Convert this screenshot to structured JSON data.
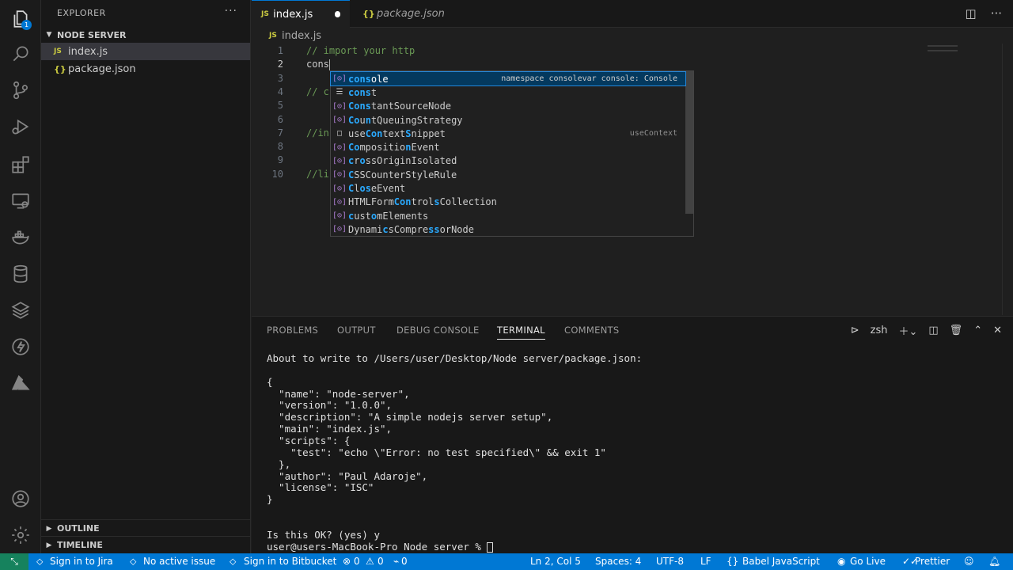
{
  "sidebar": {
    "title": "EXPLORER",
    "more": "···",
    "folder": "NODE SERVER",
    "files": [
      {
        "icon": "JS",
        "name": "index.js"
      },
      {
        "icon": "{}",
        "name": "package.json"
      }
    ],
    "outline": "OUTLINE",
    "timeline": "TIMELINE"
  },
  "activity": {
    "badge": "1"
  },
  "tabs": [
    {
      "icon": "JS",
      "label": "index.js"
    },
    {
      "icon": "{}",
      "label": "package.json"
    }
  ],
  "breadcrumb": {
    "icon": "JS",
    "file": "index.js"
  },
  "editor": {
    "lines": [
      {
        "num": "1",
        "text": "// import your http"
      },
      {
        "num": "2",
        "text": "cons"
      },
      {
        "num": "3",
        "text": ""
      },
      {
        "num": "4",
        "text": "// c"
      },
      {
        "num": "5",
        "text": ""
      },
      {
        "num": "6",
        "text": ""
      },
      {
        "num": "7",
        "text": "//in"
      },
      {
        "num": "8",
        "text": ""
      },
      {
        "num": "9",
        "text": ""
      },
      {
        "num": "10",
        "text": "//li"
      }
    ]
  },
  "suggest": {
    "items": [
      {
        "pre": "",
        "hl1": "cons",
        "mid": "ole",
        "hl2": "",
        "post": "",
        "detail": "namespace consolevar console: Console",
        "icon": "[⊙]"
      },
      {
        "pre": "",
        "hl1": "cons",
        "mid": "t",
        "hl2": "",
        "post": "",
        "detail": "",
        "icon": "☰"
      },
      {
        "pre": "",
        "hl1": "Cons",
        "mid": "tantSourceNode",
        "hl2": "",
        "post": "",
        "detail": "",
        "icon": "[⊙]"
      },
      {
        "pre": "",
        "hl1": "Co",
        "mid": "u",
        "hl2": "n",
        "post": "tQueuingStrategy",
        "detail": "",
        "icon": "[⊙]"
      },
      {
        "pre": "use",
        "hl1": "Con",
        "mid": "text",
        "hl2": "S",
        "post": "nippet",
        "detail": "useContext",
        "icon": "□"
      },
      {
        "pre": "",
        "hl1": "Co",
        "mid": "mpositio",
        "hl2": "n",
        "post": "Event",
        "detail": "",
        "icon": "[⊙]"
      },
      {
        "pre": "",
        "hl1": "c",
        "mid": "r",
        "hl2": "o",
        "post": "ssOriginIsolated",
        "detail": "",
        "icon": "[⊙]"
      },
      {
        "pre": "",
        "hl1": "C",
        "mid": "SSCounterStyleRule",
        "hl2": "",
        "post": "",
        "detail": "",
        "icon": "[⊙]"
      },
      {
        "pre": "",
        "hl1": "C",
        "mid": "l",
        "hl2": "os",
        "post": "eEvent",
        "detail": "",
        "icon": "[⊙]"
      },
      {
        "pre": "HTMLForm",
        "hl1": "Con",
        "mid": "trol",
        "hl2": "s",
        "post": "Collection",
        "detail": "",
        "icon": "[⊙]"
      },
      {
        "pre": "",
        "hl1": "c",
        "mid": "ust",
        "hl2": "o",
        "post": "mElements",
        "detail": "",
        "icon": "[⊙]"
      },
      {
        "pre": "Dynami",
        "hl1": "c",
        "mid": "sCompre",
        "hl2": "ss",
        "post": "orNode",
        "detail": "",
        "icon": "[⊙]"
      }
    ]
  },
  "panel": {
    "tabs": [
      "PROBLEMS",
      "OUTPUT",
      "DEBUG CONSOLE",
      "TERMINAL",
      "COMMENTS"
    ],
    "shell": "zsh",
    "terminal": [
      "About to write to /Users/user/Desktop/Node server/package.json:",
      "",
      "{",
      "  \"name\": \"node-server\",",
      "  \"version\": \"1.0.0\",",
      "  \"description\": \"A simple nodejs server setup\",",
      "  \"main\": \"index.js\",",
      "  \"scripts\": {",
      "    \"test\": \"echo \\\"Error: no test specified\\\" && exit 1\"",
      "  },",
      "  \"author\": \"Paul Adaroje\",",
      "  \"license\": \"ISC\"",
      "}",
      "",
      "",
      "Is this OK? (yes) y",
      "user@users-MacBook-Pro Node server % "
    ]
  },
  "status": {
    "jira": "Sign in to Jira",
    "issue": "No active issue",
    "bitbucket": "Sign in to Bitbucket",
    "errors": "0",
    "warnings": "0",
    "ports": "0",
    "position": "Ln 2, Col 5",
    "spaces": "Spaces: 4",
    "encoding": "UTF-8",
    "eol": "LF",
    "language": "Babel JavaScript",
    "golive": "Go Live",
    "prettier": "Prettier"
  }
}
